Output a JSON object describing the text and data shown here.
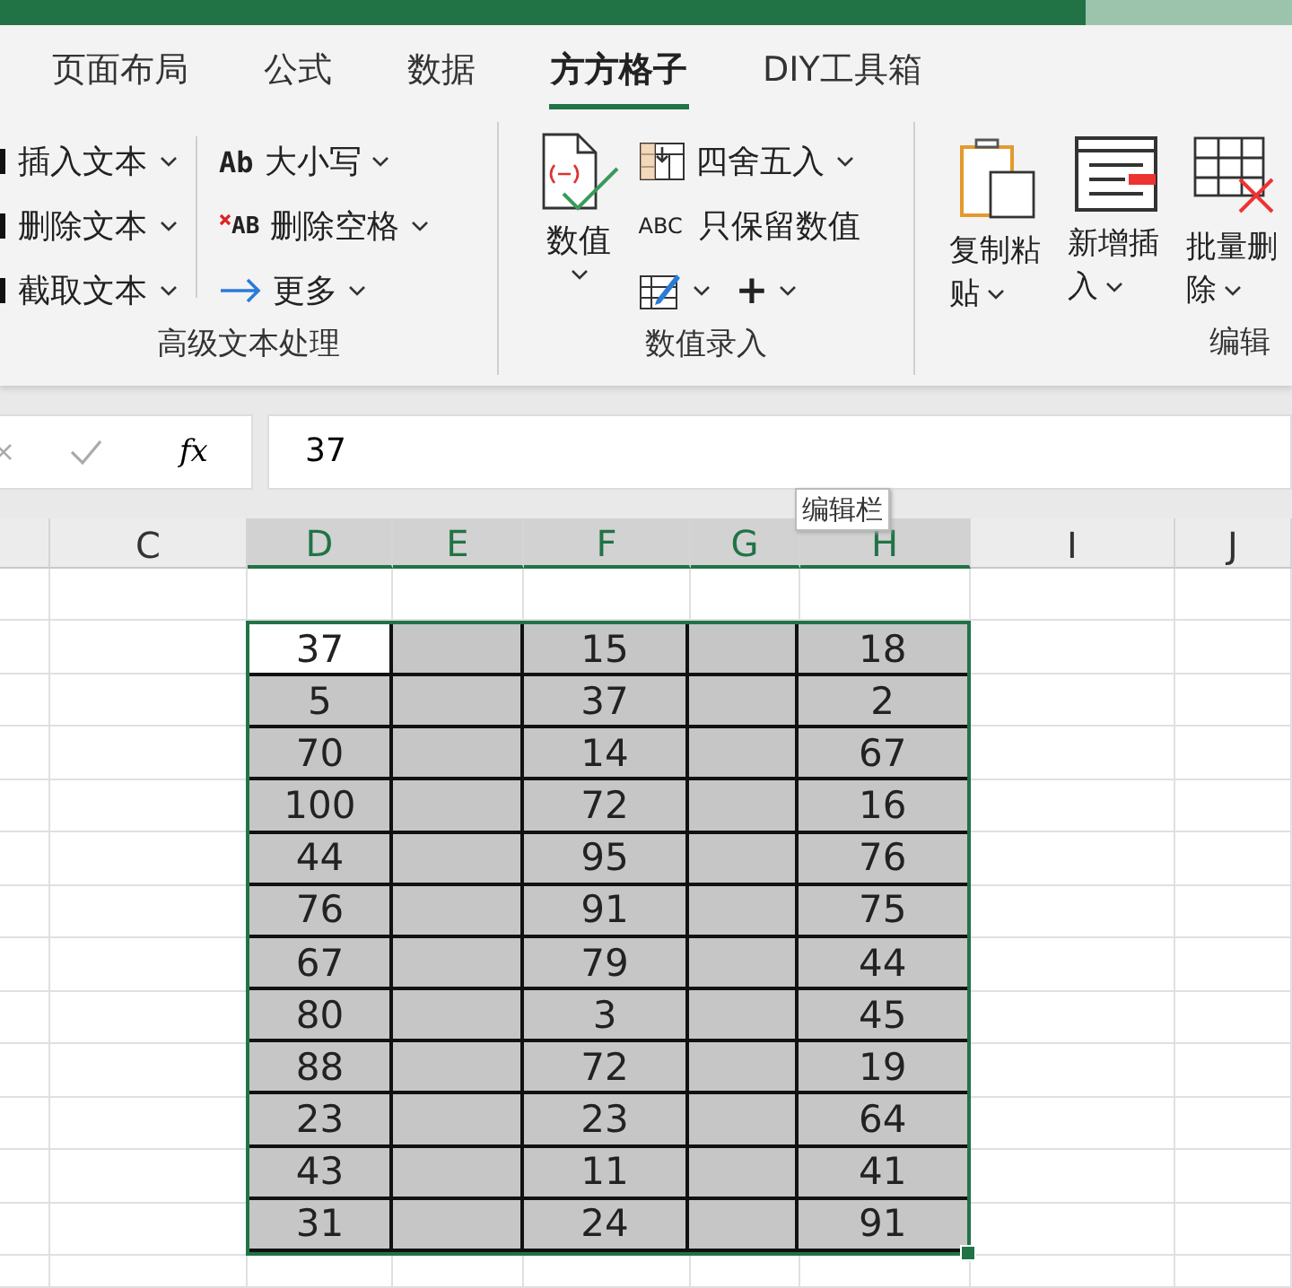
{
  "tabs": [
    {
      "label": "页面布局",
      "selected": false
    },
    {
      "label": "公式",
      "selected": false
    },
    {
      "label": "数据",
      "selected": false
    },
    {
      "label": "方方格子",
      "selected": true
    },
    {
      "label": "DIY工具箱",
      "selected": false
    }
  ],
  "ribbon": {
    "text_group": {
      "label": "高级文本处理",
      "left_items": [
        "插入文本",
        "删除文本",
        "截取文本"
      ],
      "right_items": [
        {
          "icon_text": "Ab",
          "label": "大小写"
        },
        {
          "icon_text": "AB",
          "label": "删除空格"
        },
        {
          "label": "更多"
        }
      ]
    },
    "value_group": {
      "label": "数值录入",
      "big_button": "数值",
      "items": [
        "四舍五入",
        "只保留数值"
      ],
      "abc_text": "ABC",
      "plus": "+"
    },
    "edit_group": {
      "label": "编辑",
      "buttons": [
        "复制粘贴",
        "新增插入",
        "批量删除"
      ]
    }
  },
  "formula_bar": {
    "fx": "fx",
    "value": "37"
  },
  "tooltip": "编辑栏",
  "columns": [
    {
      "label": "C",
      "selected": false
    },
    {
      "label": "D",
      "selected": true
    },
    {
      "label": "E",
      "selected": true
    },
    {
      "label": "F",
      "selected": true
    },
    {
      "label": "G",
      "selected": true
    },
    {
      "label": "H",
      "selected": true
    },
    {
      "label": "I",
      "selected": false
    },
    {
      "label": "J",
      "selected": false
    }
  ],
  "rows": [
    {
      "D": "37",
      "F": "15",
      "H": "18",
      "active": true
    },
    {
      "D": "5",
      "F": "37",
      "H": "2",
      "active": false
    },
    {
      "D": "70",
      "F": "14",
      "H": "67",
      "active": false
    },
    {
      "D": "100",
      "F": "72",
      "H": "16",
      "active": false
    },
    {
      "D": "44",
      "F": "95",
      "H": "76",
      "active": false
    },
    {
      "D": "76",
      "F": "91",
      "H": "75",
      "active": false
    },
    {
      "D": "67",
      "F": "79",
      "H": "44",
      "active": false
    },
    {
      "D": "80",
      "F": "3",
      "H": "45",
      "active": false
    },
    {
      "D": "88",
      "F": "72",
      "H": "19",
      "active": false
    },
    {
      "D": "23",
      "F": "23",
      "H": "64",
      "active": false
    },
    {
      "D": "43",
      "F": "11",
      "H": "41",
      "active": false
    },
    {
      "D": "31",
      "F": "24",
      "H": "91",
      "active": false
    }
  ]
}
